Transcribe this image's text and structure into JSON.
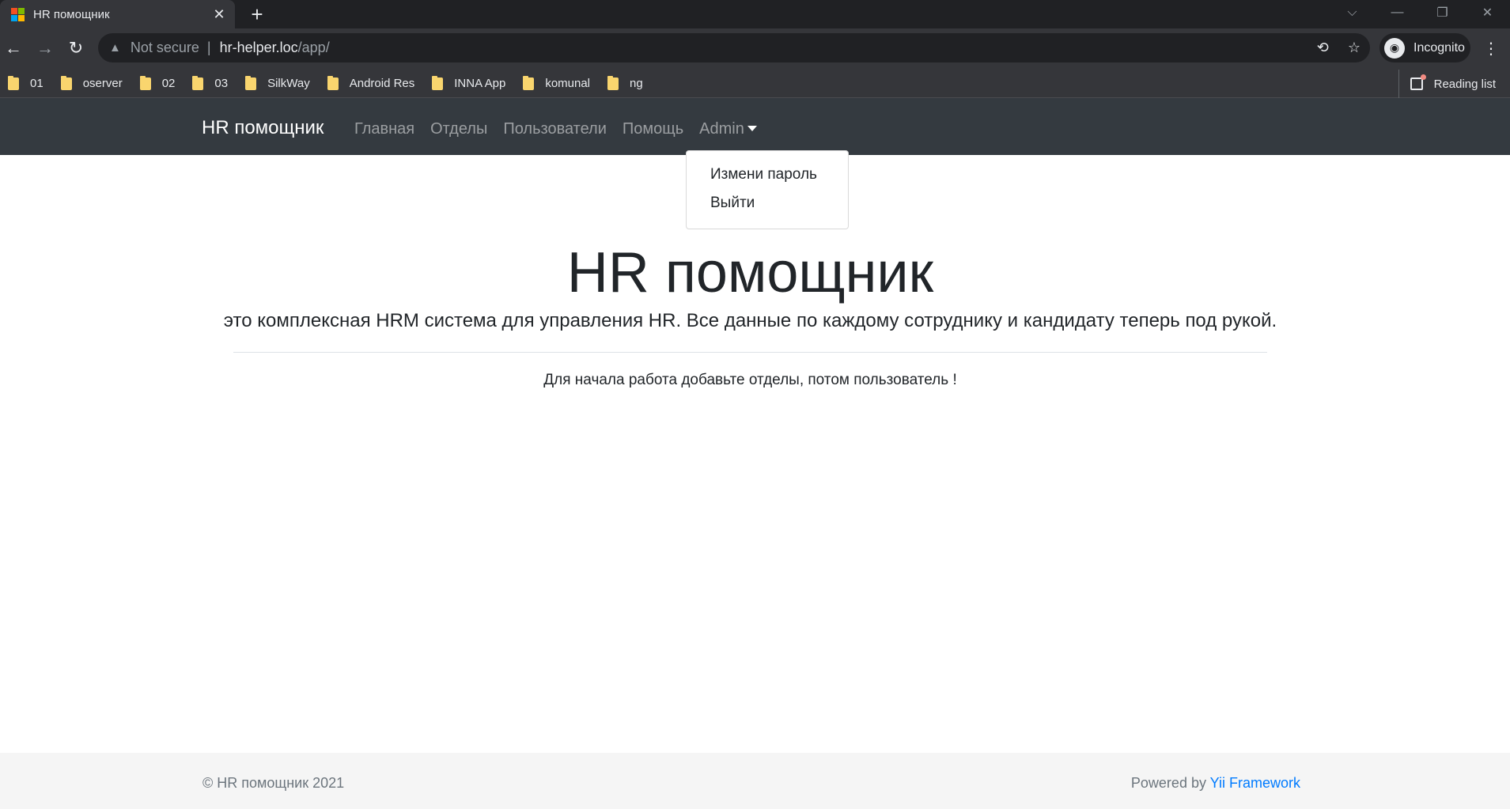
{
  "browser": {
    "tab_title": "HR помощник",
    "tab_close": "✕",
    "new_tab": "+",
    "window_controls": [
      "⌵",
      "—",
      "❐",
      "✕"
    ],
    "back": "←",
    "forward": "→",
    "reload": "↻",
    "security_label": "Not secure",
    "url_separator": "|",
    "url_host": "hr-helper.loc",
    "url_path": "/app/",
    "translate_icon": "⟲",
    "star_icon": "☆",
    "profile_label": "Incognito",
    "profile_icon": "◉",
    "menu_icon": "⋮",
    "favicon_colors": [
      "#f25022",
      "#7fba00",
      "#00a4ef",
      "#ffb900"
    ]
  },
  "bookmarks": {
    "items": [
      {
        "label": "01"
      },
      {
        "label": "oserver"
      },
      {
        "label": "02"
      },
      {
        "label": "03"
      },
      {
        "label": "SilkWay"
      },
      {
        "label": "Android Res"
      },
      {
        "label": "INNA App"
      },
      {
        "label": "komunal"
      },
      {
        "label": "ng"
      }
    ],
    "reading_list": "Reading list"
  },
  "navbar": {
    "brand": "HR помощник",
    "links": [
      "Главная",
      "Отделы",
      "Пользователи",
      "Помощь"
    ],
    "admin": "Admin",
    "dropdown": [
      "Измени пароль",
      "Выйти"
    ]
  },
  "main": {
    "title": "HR помощник",
    "lead": "это комплексная HRM система для управления HR. Все данные по каждому сотруднику и кандидату теперь под рукой.",
    "text": "Для начала работа добавьте отделы, потом пользователь !"
  },
  "footer": {
    "copyright": "© HR помощник 2021",
    "powered_prefix": "Powered by ",
    "powered_link": "Yii Framework"
  },
  "colors": {
    "navbar_bg": "#343a40",
    "link_color": "#007bff",
    "footer_bg": "#f5f5f5"
  }
}
